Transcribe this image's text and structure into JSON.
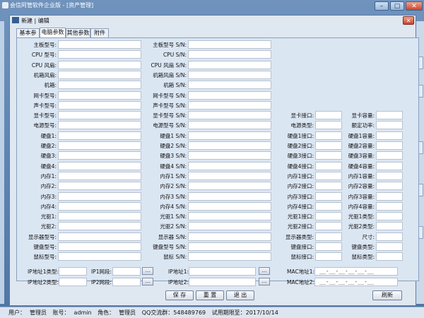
{
  "app": {
    "title": "会信阿管软件企业版 - [资产管理]",
    "win_min": "–",
    "win_max": "□",
    "win_close": "✕"
  },
  "dialog": {
    "title": "新建 | 编辑",
    "close": "✕"
  },
  "tabs": [
    "基本参数",
    "电脑参数",
    "其他参数",
    "附件"
  ],
  "col1": [
    "主板型号:",
    "CPU 型号:",
    "CPU 风扇:",
    "机箱风扇:",
    "机箱:",
    "网卡型号:",
    "声卡型号:",
    "显卡型号:",
    "电源型号:",
    "硬盘1:",
    "硬盘2:",
    "硬盘3:",
    "硬盘4:",
    "内存1:",
    "内存2:",
    "内存3:",
    "内存4:",
    "光驱1:",
    "光驱2:",
    "显示器型号:",
    "键盘型号:",
    "鼠标型号:"
  ],
  "col2": [
    "主板型号 S/N:",
    "CPU S/N:",
    "CPU 风扇 S/N:",
    "机箱风扇 S/N:",
    "机箱 S/N:",
    "网卡型号 S/N:",
    "声卡型号 S/N:",
    "显卡型号 S/N:",
    "电源型号 S/N:",
    "硬盘1 S/N:",
    "硬盘2 S/N:",
    "硬盘3 S/N:",
    "硬盘4 S/N:",
    "内存1 S/N:",
    "内存2 S/N:",
    "内存3 S/N:",
    "内存4 S/N:",
    "光驱1 S/N:",
    "光驱2 S/N:",
    "显示器 S/N:",
    "键盘型号 S/N:",
    "鼠标 S/N:"
  ],
  "col3": [
    "显卡接口:",
    "电源类型:",
    "硬盘1接口:",
    "硬盘2接口:",
    "硬盘3接口:",
    "硬盘4接口:",
    "内存1接口:",
    "内存2接口:",
    "内存3接口:",
    "内存4接口:",
    "光驱1接口:",
    "光驱2接口:",
    "显示器类型:",
    "键盘接口:",
    "鼠标接口:"
  ],
  "col4": [
    "显卡容量:",
    "额定功率:",
    "硬盘1容量:",
    "硬盘2容量:",
    "硬盘3容量:",
    "硬盘4容量:",
    "内存1容量:",
    "内存2容量:",
    "内存3容量:",
    "内存4容量:",
    "光驱1类型:",
    "光驱2类型:",
    "尺寸:",
    "键盘类型:",
    "鼠标类型:"
  ],
  "ip_row1": {
    "ip_type": "IP地址1类型:",
    "ip_seg": "IP1网段:",
    "ip_addr": "IP地址1:",
    "mac": "MAC地址1:"
  },
  "ip_row2": {
    "ip_type": "IP地址2类型:",
    "ip_seg": "IP2网段:",
    "ip_addr": "IP地址2:",
    "mac": "MAC地址2:"
  },
  "mac_mask": "__-__-__-__-__-__",
  "browse": "...",
  "actions": {
    "save": "保 存",
    "reset": "重 置",
    "exit": "退 出",
    "refresh": "刷新"
  },
  "status": {
    "user_label": "用户：",
    "user": "管理员",
    "account_label": "账号：",
    "account": "admin",
    "role_label": "角色：",
    "role": "管理员",
    "qq": "QQ交流群：548489769",
    "trial": "试用期限至：2017/10/14"
  }
}
